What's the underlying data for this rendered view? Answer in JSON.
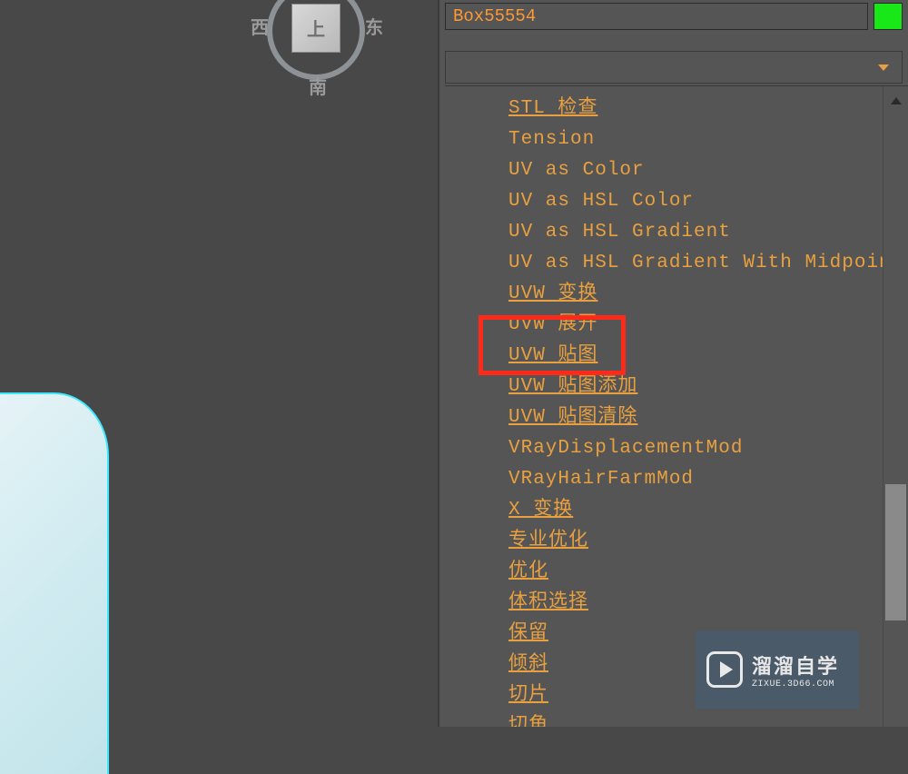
{
  "viewport": {
    "cube_face": "上",
    "compass_w": "西",
    "compass_e": "东",
    "compass_s": "南"
  },
  "panel": {
    "object_name": "Box55554",
    "swatch_color": "#18e818"
  },
  "modifiers": {
    "items": [
      {
        "label": "STL 检查",
        "underlined": true
      },
      {
        "label": "Tension",
        "underlined": false
      },
      {
        "label": "UV as Color",
        "underlined": false
      },
      {
        "label": "UV as HSL Color",
        "underlined": false
      },
      {
        "label": "UV as HSL Gradient",
        "underlined": false
      },
      {
        "label": "UV as HSL Gradient With Midpoint",
        "underlined": false
      },
      {
        "label": "UVW 变换",
        "underlined": true
      },
      {
        "label": "UVW 展开",
        "underlined": false
      },
      {
        "label": "UVW 贴图",
        "underlined": true
      },
      {
        "label": "UVW 贴图添加",
        "underlined": true
      },
      {
        "label": "UVW 贴图清除",
        "underlined": true
      },
      {
        "label": "VRayDisplacementMod",
        "underlined": false
      },
      {
        "label": "VRayHairFarmMod",
        "underlined": false
      },
      {
        "label": "X 变换",
        "underlined": true
      },
      {
        "label": "专业优化",
        "underlined": true
      },
      {
        "label": "优化",
        "underlined": true
      },
      {
        "label": "体积选择",
        "underlined": true
      },
      {
        "label": "保留",
        "underlined": true
      },
      {
        "label": "倾斜",
        "underlined": true
      },
      {
        "label": "切片",
        "underlined": true
      },
      {
        "label": "切角",
        "underlined": true
      }
    ]
  },
  "watermark": {
    "main": "溜溜自学",
    "sub": "ZIXUE.3D66.COM"
  }
}
